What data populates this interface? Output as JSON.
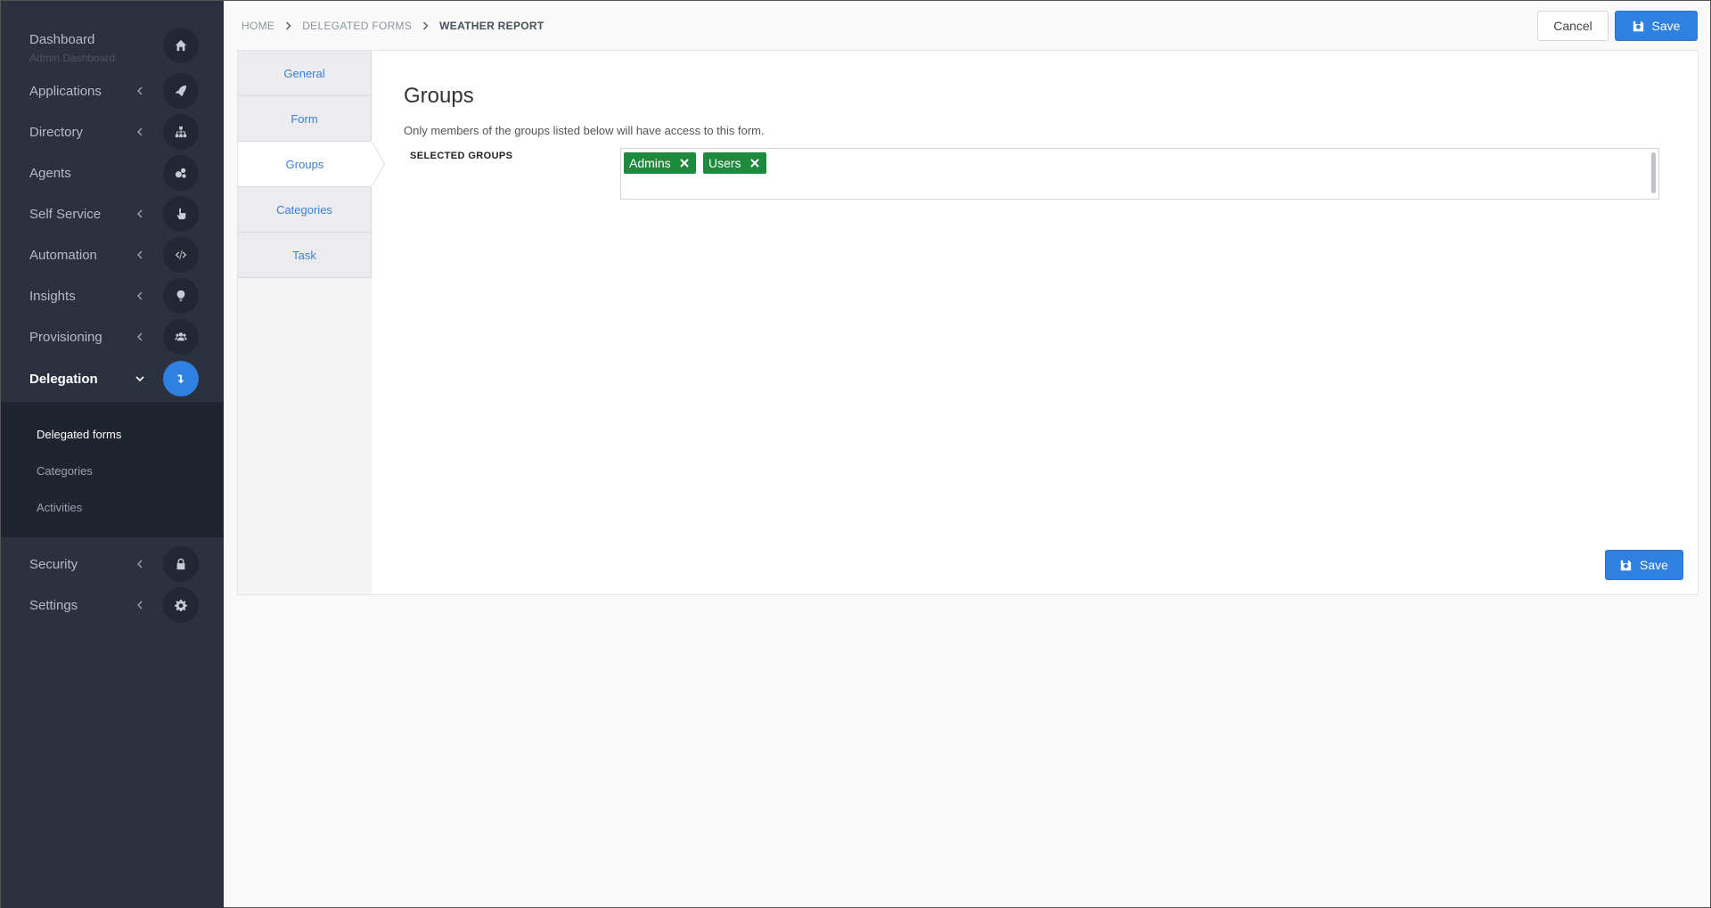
{
  "sidebar": {
    "dashboard": {
      "label": "Dashboard",
      "sublabel": "Admin Dashboard",
      "icon": "home-icon"
    },
    "items": [
      {
        "label": "Applications",
        "icon": "rocket-icon"
      },
      {
        "label": "Directory",
        "icon": "sitemap-icon"
      },
      {
        "label": "Agents",
        "icon": "cogs-icon"
      },
      {
        "label": "Self Service",
        "icon": "hand-pointer-icon"
      },
      {
        "label": "Automation",
        "icon": "code-icon"
      },
      {
        "label": "Insights",
        "icon": "lightbulb-icon"
      },
      {
        "label": "Provisioning",
        "icon": "users-icon"
      },
      {
        "label": "Delegation",
        "icon": "level-down-icon"
      },
      {
        "label": "Security",
        "icon": "lock-icon"
      },
      {
        "label": "Settings",
        "icon": "gear-icon"
      }
    ],
    "delegation_submenu": [
      "Delegated forms",
      "Categories",
      "Activities"
    ]
  },
  "breadcrumb": [
    "HOME",
    "DELEGATED FORMS",
    "WEATHER REPORT"
  ],
  "header": {
    "cancel_label": "Cancel",
    "save_label": "Save"
  },
  "tabs": [
    "General",
    "Form",
    "Groups",
    "Categories",
    "Task"
  ],
  "active_tab": "Groups",
  "main": {
    "title": "Groups",
    "description": "Only members of the groups listed below will have access to this form.",
    "field_label": "SELECTED GROUPS",
    "selected_groups": [
      "Admins",
      "Users"
    ],
    "save_label": "Save"
  },
  "colors": {
    "sidebar_bg": "#2c3140",
    "accent": "#2f80e0",
    "tag_green": "#1e8a3e"
  }
}
